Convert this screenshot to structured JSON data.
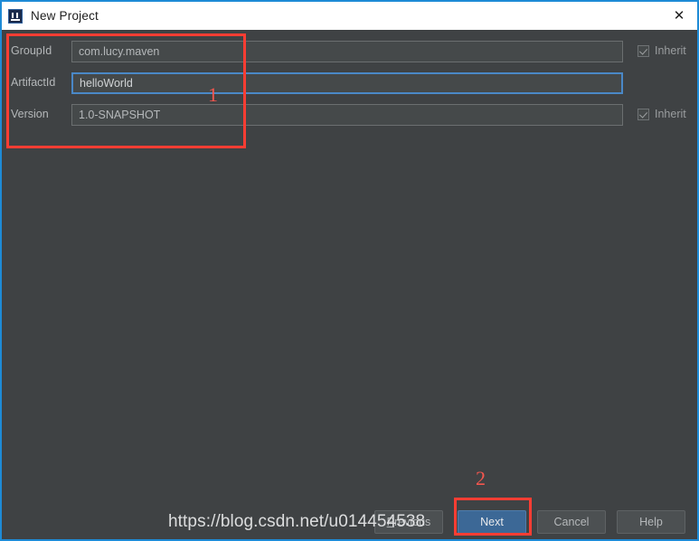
{
  "window": {
    "title": "New Project",
    "icon": "intellij-idea-icon",
    "close_icon": "✕",
    "border_color": "#1e8bd6",
    "background_color": "#3f4244",
    "titlebar_background": "#ffffff"
  },
  "form": {
    "rows": [
      {
        "label": "GroupId",
        "value": "com.lucy.maven",
        "focused": false,
        "inherit": {
          "label": "Inherit",
          "checked": true,
          "enabled": false
        }
      },
      {
        "label": "ArtifactId",
        "value": "helloWorld",
        "focused": true,
        "inherit": null
      },
      {
        "label": "Version",
        "value": "1.0-SNAPSHOT",
        "focused": false,
        "inherit": {
          "label": "Inherit",
          "checked": true,
          "enabled": false
        }
      }
    ]
  },
  "buttons": {
    "previous": {
      "label": "Previous",
      "mnemonic": "P",
      "rest": "revious",
      "primary": false
    },
    "next": {
      "label": "Next",
      "primary": true
    },
    "cancel": {
      "label": "Cancel",
      "primary": false
    },
    "help": {
      "label": "Help",
      "primary": false
    }
  },
  "annotations": {
    "marker_color": "#fc3d33",
    "items": [
      {
        "number": "1",
        "target": "maven-coordinates-fields"
      },
      {
        "number": "2",
        "target": "next-button"
      }
    ]
  },
  "watermark": {
    "text": "https://blog.csdn.net/u014454538"
  }
}
